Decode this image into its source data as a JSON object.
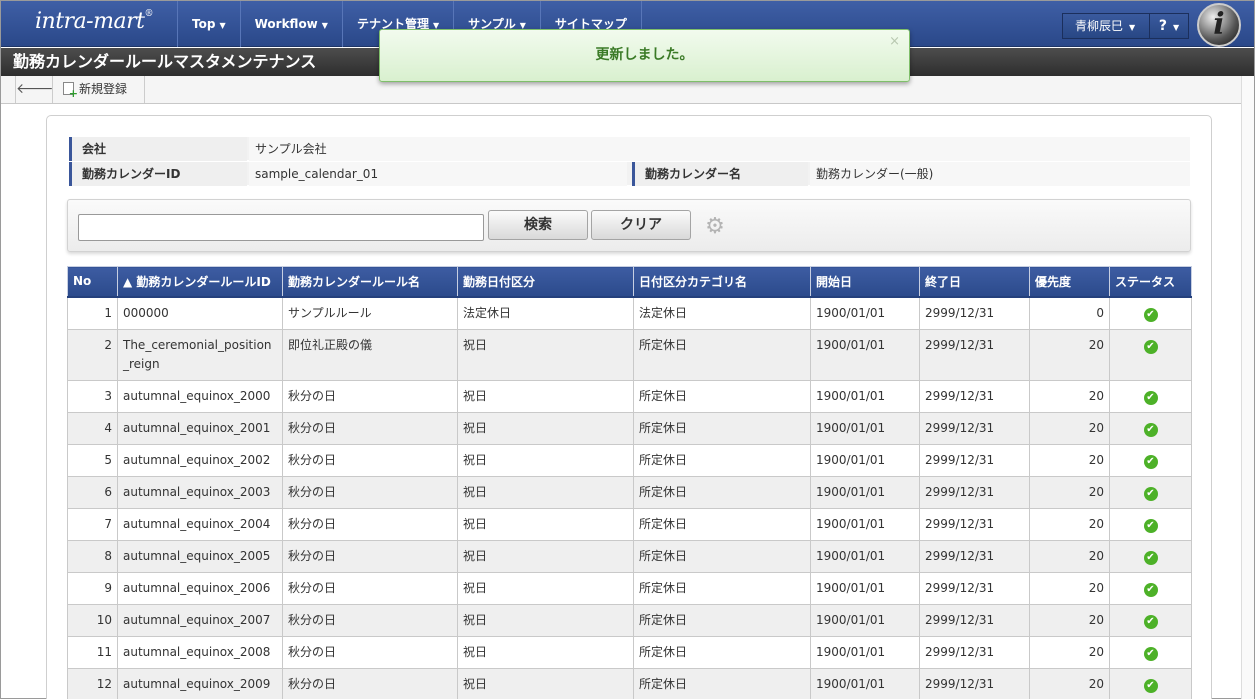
{
  "app": {
    "logo": "intra-mart",
    "logo_mark": "®",
    "brand_mark": "i"
  },
  "menu": [
    {
      "label": "Top",
      "caret": "▼"
    },
    {
      "label": "Workflow",
      "caret": "▼"
    },
    {
      "label": "テナント管理",
      "caret": "▼"
    },
    {
      "label": "サンプル",
      "caret": "▼"
    },
    {
      "label": "サイトマップ",
      "caret": ""
    }
  ],
  "user": {
    "name": "青柳辰巳",
    "caret": "▼",
    "help": "?"
  },
  "page_title": "勤務カレンダールールマスタメンテナンス",
  "toolbar": {
    "back_icon": "🡐",
    "new_label": "新規登録"
  },
  "notice": {
    "message": "更新しました。",
    "close": "×"
  },
  "info": {
    "company_label": "会社",
    "company_value": "サンプル会社",
    "calendar_id_label": "勤務カレンダーID",
    "calendar_id_value": "sample_calendar_01",
    "calendar_name_label": "勤務カレンダー名",
    "calendar_name_value": "勤務カレンダー(一般)"
  },
  "search": {
    "value": "",
    "placeholder": "",
    "search_label": "検索",
    "clear_label": "クリア"
  },
  "table": {
    "headers": [
      "No",
      "▲ 勤務カレンダールールID",
      "勤務カレンダールール名",
      "勤務日付区分",
      "日付区分カテゴリ名",
      "開始日",
      "終了日",
      "優先度",
      "ステータス"
    ],
    "rows": [
      {
        "no": "1",
        "id": "000000",
        "name": "サンプルルール",
        "date_type": "法定休日",
        "category": "法定休日",
        "start": "1900/01/01",
        "end": "2999/12/31",
        "priority": "0",
        "status": "✔"
      },
      {
        "no": "2",
        "id": "The_ceremonial_position_reign",
        "name": "即位礼正殿の儀",
        "date_type": "祝日",
        "category": "所定休日",
        "start": "1900/01/01",
        "end": "2999/12/31",
        "priority": "20",
        "status": "✔"
      },
      {
        "no": "3",
        "id": "autumnal_equinox_2000",
        "name": "秋分の日",
        "date_type": "祝日",
        "category": "所定休日",
        "start": "1900/01/01",
        "end": "2999/12/31",
        "priority": "20",
        "status": "✔"
      },
      {
        "no": "4",
        "id": "autumnal_equinox_2001",
        "name": "秋分の日",
        "date_type": "祝日",
        "category": "所定休日",
        "start": "1900/01/01",
        "end": "2999/12/31",
        "priority": "20",
        "status": "✔"
      },
      {
        "no": "5",
        "id": "autumnal_equinox_2002",
        "name": "秋分の日",
        "date_type": "祝日",
        "category": "所定休日",
        "start": "1900/01/01",
        "end": "2999/12/31",
        "priority": "20",
        "status": "✔"
      },
      {
        "no": "6",
        "id": "autumnal_equinox_2003",
        "name": "秋分の日",
        "date_type": "祝日",
        "category": "所定休日",
        "start": "1900/01/01",
        "end": "2999/12/31",
        "priority": "20",
        "status": "✔"
      },
      {
        "no": "7",
        "id": "autumnal_equinox_2004",
        "name": "秋分の日",
        "date_type": "祝日",
        "category": "所定休日",
        "start": "1900/01/01",
        "end": "2999/12/31",
        "priority": "20",
        "status": "✔"
      },
      {
        "no": "8",
        "id": "autumnal_equinox_2005",
        "name": "秋分の日",
        "date_type": "祝日",
        "category": "所定休日",
        "start": "1900/01/01",
        "end": "2999/12/31",
        "priority": "20",
        "status": "✔"
      },
      {
        "no": "9",
        "id": "autumnal_equinox_2006",
        "name": "秋分の日",
        "date_type": "祝日",
        "category": "所定休日",
        "start": "1900/01/01",
        "end": "2999/12/31",
        "priority": "20",
        "status": "✔"
      },
      {
        "no": "10",
        "id": "autumnal_equinox_2007",
        "name": "秋分の日",
        "date_type": "祝日",
        "category": "所定休日",
        "start": "1900/01/01",
        "end": "2999/12/31",
        "priority": "20",
        "status": "✔"
      },
      {
        "no": "11",
        "id": "autumnal_equinox_2008",
        "name": "秋分の日",
        "date_type": "祝日",
        "category": "所定休日",
        "start": "1900/01/01",
        "end": "2999/12/31",
        "priority": "20",
        "status": "✔"
      },
      {
        "no": "12",
        "id": "autumnal_equinox_2009",
        "name": "秋分の日",
        "date_type": "祝日",
        "category": "所定休日",
        "start": "1900/01/01",
        "end": "2999/12/31",
        "priority": "20",
        "status": "✔"
      }
    ]
  }
}
